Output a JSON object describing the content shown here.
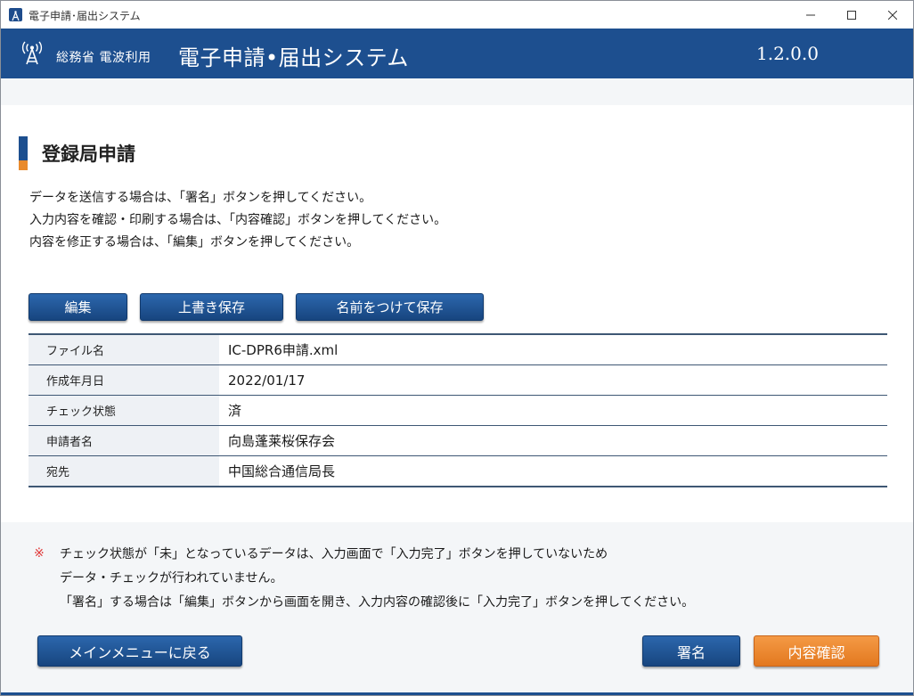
{
  "window": {
    "title": "電子申請･届出システム"
  },
  "banner": {
    "org": "総務省 電波利用",
    "system_name": "電子申請•届出システム",
    "version": "1.2.0.0"
  },
  "page": {
    "title": "登録局申請",
    "intro": [
      "データを送信する場合は、「署名」ボタンを押してください。",
      "入力内容を確認・印刷する場合は、「内容確認」ボタンを押してください。",
      "内容を修正する場合は、「編集」ボタンを押してください。"
    ]
  },
  "toolbar": {
    "edit_label": "編集",
    "save_label": "上書き保存",
    "save_as_label": "名前をつけて保存"
  },
  "info_table": [
    {
      "label": "ファイル名",
      "value": "IC-DPR6申請.xml"
    },
    {
      "label": "作成年月日",
      "value": "2022/01/17"
    },
    {
      "label": "チェック状態",
      "value": "済"
    },
    {
      "label": "申請者名",
      "value": "向島蓬莱桜保存会"
    },
    {
      "label": "宛先",
      "value": "中国総合通信局長"
    }
  ],
  "note": {
    "mark": "※",
    "lines": [
      "チェック状態が「未」となっているデータは、入力画面で「入力完了」ボタンを押していないため",
      "データ・チェックが行われていません。",
      "「署名」する場合は「編集」ボタンから画面を開き、入力内容の確認後に「入力完了」ボタンを押してください。"
    ]
  },
  "footer": {
    "back_label": "メインメニューに戻る",
    "sign_label": "署名",
    "confirm_label": "内容確認"
  },
  "colors": {
    "brand": "#1d4f8f",
    "accent": "#e98a2c"
  }
}
